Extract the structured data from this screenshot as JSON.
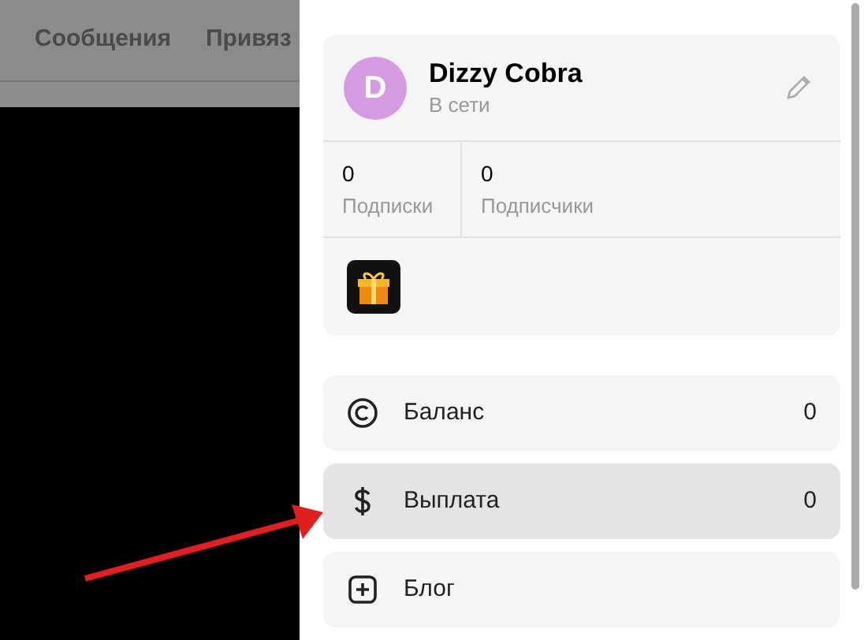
{
  "top_nav": [
    {
      "label": "Сообщения"
    },
    {
      "label": "Привяз"
    }
  ],
  "profile": {
    "avatar_letter": "D",
    "name": "Dizzy Cobra",
    "status": "В сети",
    "stats": [
      {
        "value": "0",
        "label": "Подписки"
      },
      {
        "value": "0",
        "label": "Подписчики"
      }
    ]
  },
  "menu": [
    {
      "kind": "balance",
      "label": "Баланс",
      "value": "0",
      "selected": false
    },
    {
      "kind": "payout",
      "label": "Выплата",
      "value": "0",
      "selected": true
    },
    {
      "kind": "blog",
      "label": "Блог",
      "selected": false
    }
  ]
}
